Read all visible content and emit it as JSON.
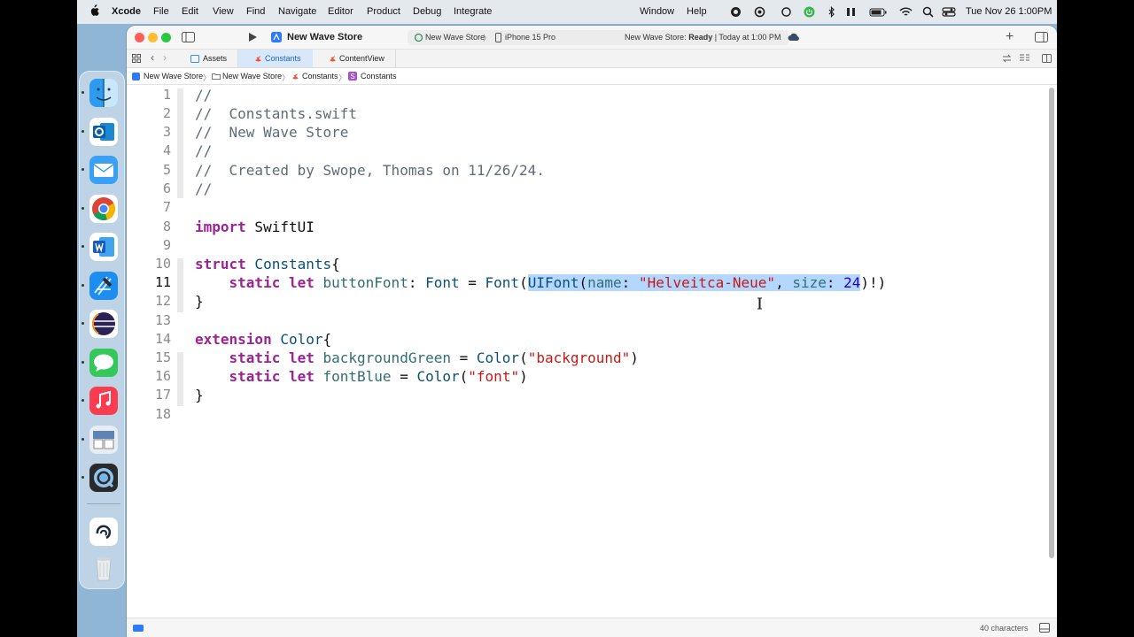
{
  "menubar": {
    "app_name": "Xcode",
    "items": [
      "File",
      "Edit",
      "View",
      "Find",
      "Navigate",
      "Editor",
      "Product",
      "Debug",
      "Integrate"
    ],
    "right_items": [
      "Window",
      "Help"
    ],
    "clock": "Tue Nov 26  1:00PM"
  },
  "window": {
    "project_title": "New Wave Store",
    "scheme": "New Wave Store",
    "device": "iPhone 15 Pro",
    "status_prefix": "New Wave Store: ",
    "status_state": "Ready",
    "status_time": " | Today at 1:00 PM"
  },
  "tabs": [
    {
      "label": "Assets",
      "icon": "assets-icon"
    },
    {
      "label": "Constants",
      "icon": "swift-icon"
    },
    {
      "label": "ContentView",
      "icon": "swift-icon"
    }
  ],
  "breadcrumb": [
    "New Wave Store",
    "New Wave Store",
    "Constants",
    "Constants"
  ],
  "editor": {
    "line_numbers": [
      "1",
      "2",
      "3",
      "4",
      "5",
      "6",
      "7",
      "8",
      "9",
      "10",
      "11",
      "12",
      "13",
      "14",
      "15",
      "16",
      "17",
      "18"
    ],
    "current_line": "11",
    "lines": {
      "l1": "//",
      "l2": "//  Constants.swift",
      "l3": "//  New Wave Store",
      "l4": "//",
      "l5": "//  Created by Swope, Thomas on 11/26/24.",
      "l6": "//",
      "l8_kw": "import",
      "l8_rest": " SwiftUI",
      "l10_kw": "struct",
      "l10_name": " Constants",
      "l10_end": "{",
      "l11_indent": "    ",
      "l11_kw": "static let",
      "l11_prop": " buttonFont",
      "l11_colon": ": ",
      "l11_type": "Font",
      "l11_eq": " = ",
      "l11_font": "Font",
      "l11_paren": "(",
      "l11_sel_type": "UIFont",
      "l11_sel_open": "(",
      "l11_sel_name": "name",
      "l11_sel_c1": ": ",
      "l11_sel_str": "\"Helveitca-Neue\"",
      "l11_sel_comma": ", ",
      "l11_sel_size": "size",
      "l11_sel_c2": ": ",
      "l11_sel_num": "24",
      "l11_close": ")!)",
      "l12": "}",
      "l14_kw": "extension",
      "l14_type": " Color",
      "l14_end": "{",
      "l15_indent": "    ",
      "l15_kw": "static let",
      "l15_prop": " backgroundGreen",
      "l15_eq": " = ",
      "l15_type": "Color",
      "l15_open": "(",
      "l15_str": "\"background\"",
      "l15_close": ")",
      "l16_indent": "    ",
      "l16_kw": "static let",
      "l16_prop": " fontBlue",
      "l16_eq": " = ",
      "l16_type": "Color",
      "l16_open": "(",
      "l16_str": "\"font\"",
      "l16_close": ")",
      "l17": "}"
    }
  },
  "statusbar": {
    "chars": "40 characters"
  },
  "colors": {
    "keyword": "#9b2393",
    "type": "#0b4f79",
    "string": "#c41a16",
    "comment": "#5d6c79",
    "selection": "#b3d7ff"
  }
}
